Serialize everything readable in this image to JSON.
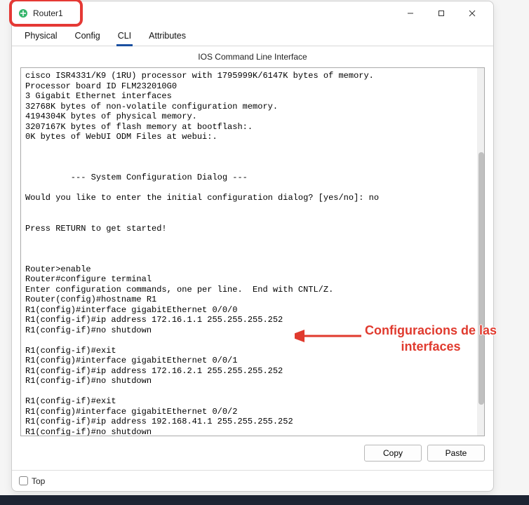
{
  "window": {
    "title": "Router1"
  },
  "tabs": {
    "physical": "Physical",
    "config": "Config",
    "cli": "CLI",
    "attributes": "Attributes"
  },
  "cliHeader": "IOS Command Line Interface",
  "cliContent": "cisco ISR4331/K9 (1RU) processor with 1795999K/6147K bytes of memory.\nProcessor board ID FLM232010G0\n3 Gigabit Ethernet interfaces\n32768K bytes of non-volatile configuration memory.\n4194304K bytes of physical memory.\n3207167K bytes of flash memory at bootflash:.\n0K bytes of WebUI ODM Files at webui:.\n\n\n\n         --- System Configuration Dialog ---\n\nWould you like to enter the initial configuration dialog? [yes/no]: no\n\n\nPress RETURN to get started!\n\n\n\nRouter>enable\nRouter#configure terminal\nEnter configuration commands, one per line.  End with CNTL/Z.\nRouter(config)#hostname R1\nR1(config)#interface gigabitEthernet 0/0/0\nR1(config-if)#ip address 172.16.1.1 255.255.255.252\nR1(config-if)#no shutdown\n\nR1(config-if)#exit\nR1(config)#interface gigabitEthernet 0/0/1\nR1(config-if)#ip address 172.16.2.1 255.255.255.252\nR1(config-if)#no shutdown\n\nR1(config-if)#exit\nR1(config)#interface gigabitEthernet 0/0/2\nR1(config-if)#ip address 192.168.41.1 255.255.255.252\nR1(config-if)#no shutdown",
  "buttons": {
    "copy": "Copy",
    "paste": "Paste"
  },
  "footer": {
    "top": "Top"
  },
  "annotation": {
    "line1": "Configuracions de las",
    "line2": "interfaces"
  }
}
